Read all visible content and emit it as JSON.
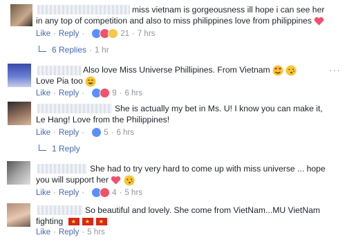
{
  "comments": [
    {
      "line1": "miss vietnam is gorgeousness ill hope i can see her",
      "line2": "in any top of competition and also to miss philippines love from philippines",
      "like": "Like",
      "reply": "Reply",
      "react_count": "21",
      "time": "7 hrs",
      "replies_label": "6 Replies",
      "replies_time": "1 hr"
    },
    {
      "line1": "Also love Miss Universe Phillipines. From Vietnam",
      "line2": "Love Pia too",
      "like": "Like",
      "reply": "Reply",
      "react_count": "9",
      "time": "6 hrs"
    },
    {
      "line1": "She is actually my bet in Ms. U! I know you can make it,",
      "line2": "Le Hang! Love from the Philippines!",
      "like": "Like",
      "reply": "Reply",
      "react_count": "5",
      "time": "6 hrs",
      "replies_label": "1 Reply"
    },
    {
      "line1": "She had to try very hard to come up with miss universe ... hope",
      "line2": "you will support her",
      "like": "Like",
      "reply": "Reply",
      "react_count": "4",
      "time": "5 hrs"
    },
    {
      "line1": "So beautiful and lovely. She come from VietNam...MU VietNam",
      "line2": "fighting",
      "like": "Like",
      "reply": "Reply",
      "time": "5 hrs"
    }
  ],
  "colors": {
    "link": "#4267b2",
    "meta": "#90949c",
    "text": "#1d2129"
  },
  "icons": [
    "heart-icon",
    "heart-eyes-emoji",
    "kiss-emoji",
    "smile-emoji",
    "vietnam-flag-icon",
    "more-options-icon"
  ]
}
